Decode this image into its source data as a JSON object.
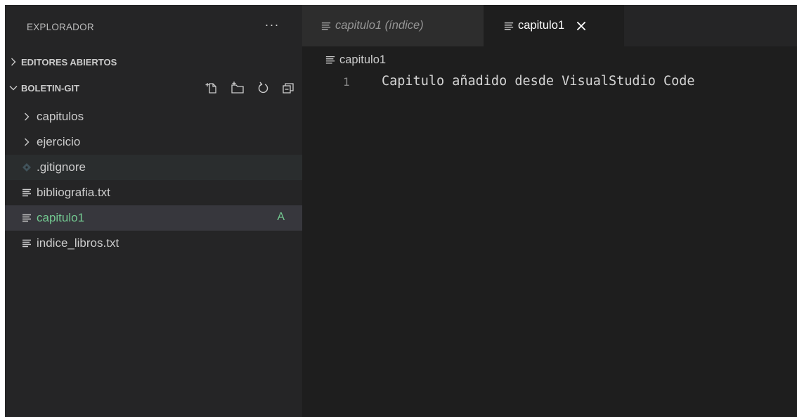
{
  "explorer": {
    "title": "EXPLORADOR",
    "more_label": "···",
    "open_editors_label": "EDITORES ABIERTOS",
    "workspace_label": "BOLETIN-GIT",
    "tree": [
      {
        "label": "capitulos",
        "type": "folder"
      },
      {
        "label": "ejercicio",
        "type": "folder"
      },
      {
        "label": ".gitignore",
        "type": "file"
      },
      {
        "label": "bibliografia.txt",
        "type": "file"
      },
      {
        "label": "capitulo1",
        "type": "file",
        "git_status": "A"
      },
      {
        "label": "indice_libros.txt",
        "type": "file"
      }
    ],
    "action_icons": [
      "new-file-icon",
      "new-folder-icon",
      "refresh-icon",
      "collapse-all-icon"
    ]
  },
  "tabs": [
    {
      "label": "capitulo1 (índice)",
      "state": "inactive",
      "preview": true
    },
    {
      "label": "capitulo1",
      "state": "active",
      "close_glyph": "✕"
    }
  ],
  "breadcrumb": {
    "file": "capitulo1"
  },
  "editor": {
    "lines": [
      {
        "number": "1",
        "text": "Capitulo añadido desde VisualStudio Code"
      }
    ]
  },
  "colors": {
    "sidebar_bg": "#252526",
    "editor_bg": "#1e1e1e",
    "git_added": "#73c991",
    "selection_bg": "#37373d"
  }
}
